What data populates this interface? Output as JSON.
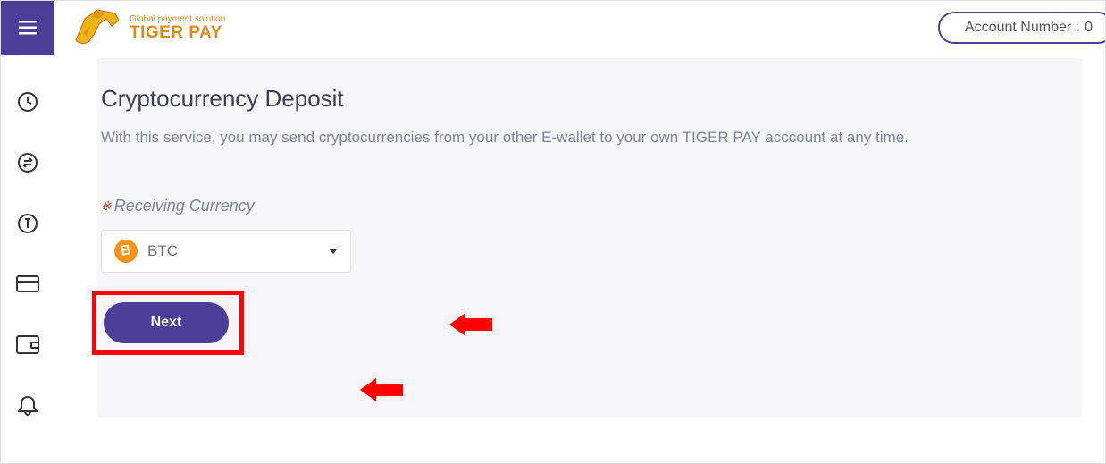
{
  "header": {
    "logo_tagline": "Global payment solution",
    "logo_name": "TIGER PAY",
    "account_label": "Account Number :",
    "account_number": "0"
  },
  "sidebar": {
    "items": [
      {
        "name": "clock-icon"
      },
      {
        "name": "exchange-icon"
      },
      {
        "name": "token-icon"
      },
      {
        "name": "card-icon"
      },
      {
        "name": "wallet-icon"
      },
      {
        "name": "bell-icon"
      }
    ]
  },
  "page": {
    "title": "Cryptocurrency Deposit",
    "description": "With this service, you may send cryptocurrencies from your other E-wallet to your own TIGER PAY acccount at any time.",
    "required_mark": "※",
    "currency_label": "Receiving Currency",
    "selected_currency": "BTC",
    "next_button": "Next"
  }
}
